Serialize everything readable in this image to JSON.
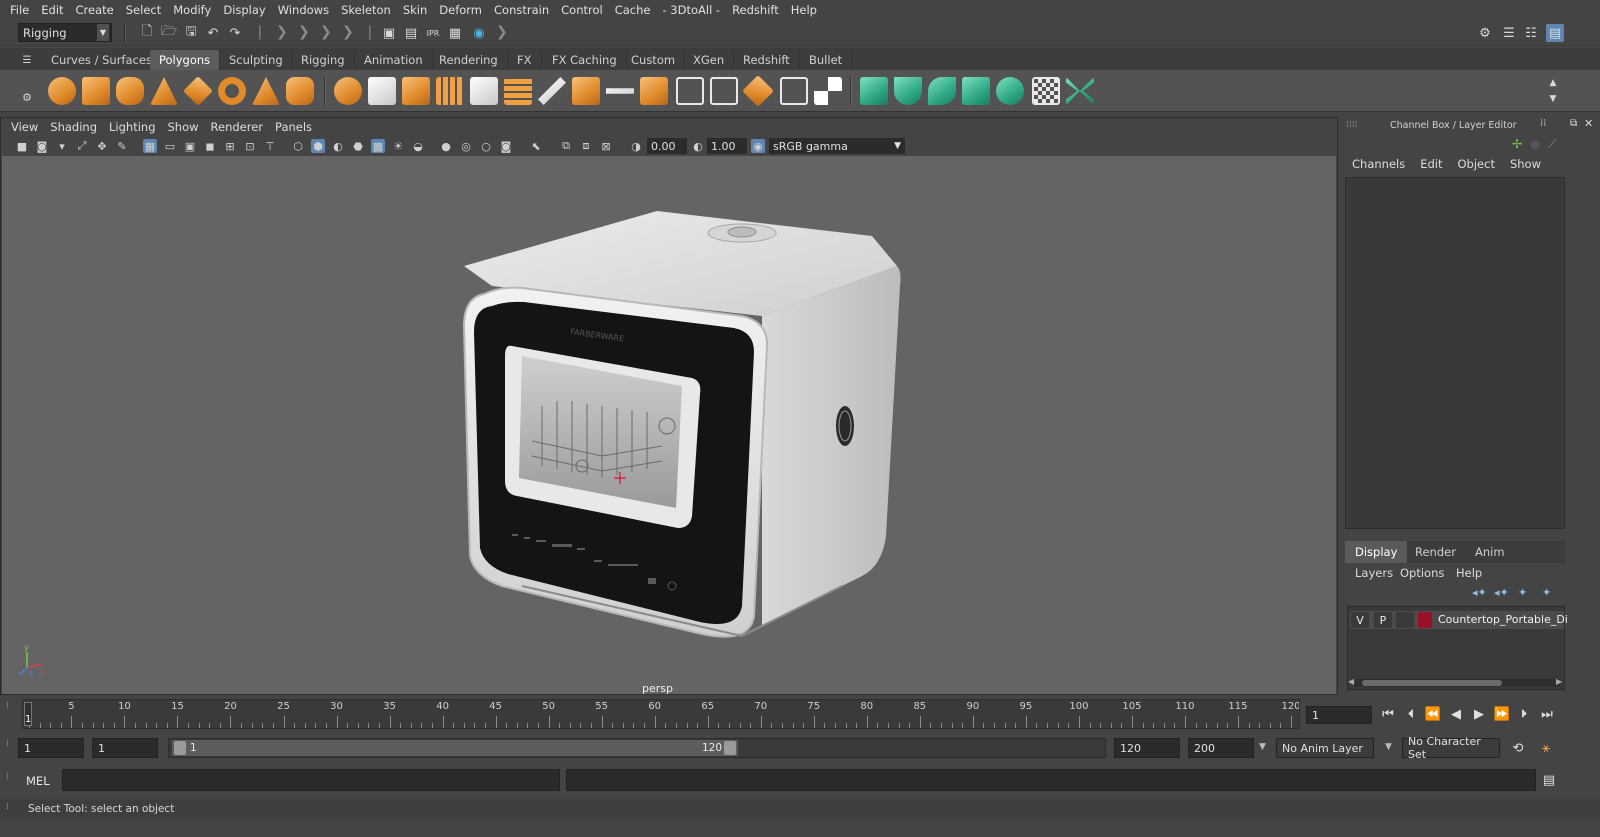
{
  "menubar": {
    "items": [
      "File",
      "Edit",
      "Create",
      "Select",
      "Modify",
      "Display",
      "Windows",
      "Skeleton",
      "Skin",
      "Deform",
      "Constrain",
      "Control",
      "Cache",
      "- 3DtoAll -",
      "Redshift",
      "Help"
    ]
  },
  "statusline": {
    "menuset": "Rigging"
  },
  "shelf": {
    "tabs": [
      "Curves / Surfaces",
      "Polygons",
      "Sculpting",
      "Rigging",
      "Animation",
      "Rendering",
      "FX",
      "FX Caching",
      "Custom",
      "XGen",
      "Redshift",
      "Bullet"
    ],
    "active_tab": "Polygons"
  },
  "viewport": {
    "menu": [
      "View",
      "Shading",
      "Lighting",
      "Show",
      "Renderer",
      "Panels"
    ],
    "exposure": "0.00",
    "gamma": "1.00",
    "color_space": "sRGB gamma",
    "camera": "persp",
    "model": {
      "brand": "FARBERWARE"
    },
    "axis": {
      "x": "x",
      "y": "y",
      "z": "z"
    }
  },
  "channelbox": {
    "title": "Channel Box / Layer Editor",
    "menu": [
      "Channels",
      "Edit",
      "Object",
      "Show"
    ]
  },
  "layereditor": {
    "tabs": [
      "Display",
      "Render",
      "Anim"
    ],
    "active_tab": "Display",
    "menu": [
      "Layers",
      "Options",
      "Help"
    ],
    "layers": [
      {
        "visible": "V",
        "playback": "P",
        "color": "#9b1028",
        "name": "Countertop_Portable_Di"
      }
    ]
  },
  "timeslider": {
    "labels": [
      "1",
      "5",
      "10",
      "15",
      "20",
      "25",
      "30",
      "35",
      "40",
      "45",
      "50",
      "55",
      "60",
      "65",
      "70",
      "75",
      "80",
      "85",
      "90",
      "95",
      "100",
      "105",
      "110",
      "115",
      "120"
    ],
    "current_frame": "1",
    "current_frame_field": "1"
  },
  "rangeslider": {
    "start_time": "1",
    "playback_start": "1",
    "range_start_label": "1",
    "range_end_label": "120",
    "playback_end": "120",
    "end_time": "200",
    "anim_layer": "No Anim Layer",
    "character_set": "No Character Set"
  },
  "commandline": {
    "label": "MEL"
  },
  "helpline": {
    "text": "Select Tool: select an object"
  }
}
